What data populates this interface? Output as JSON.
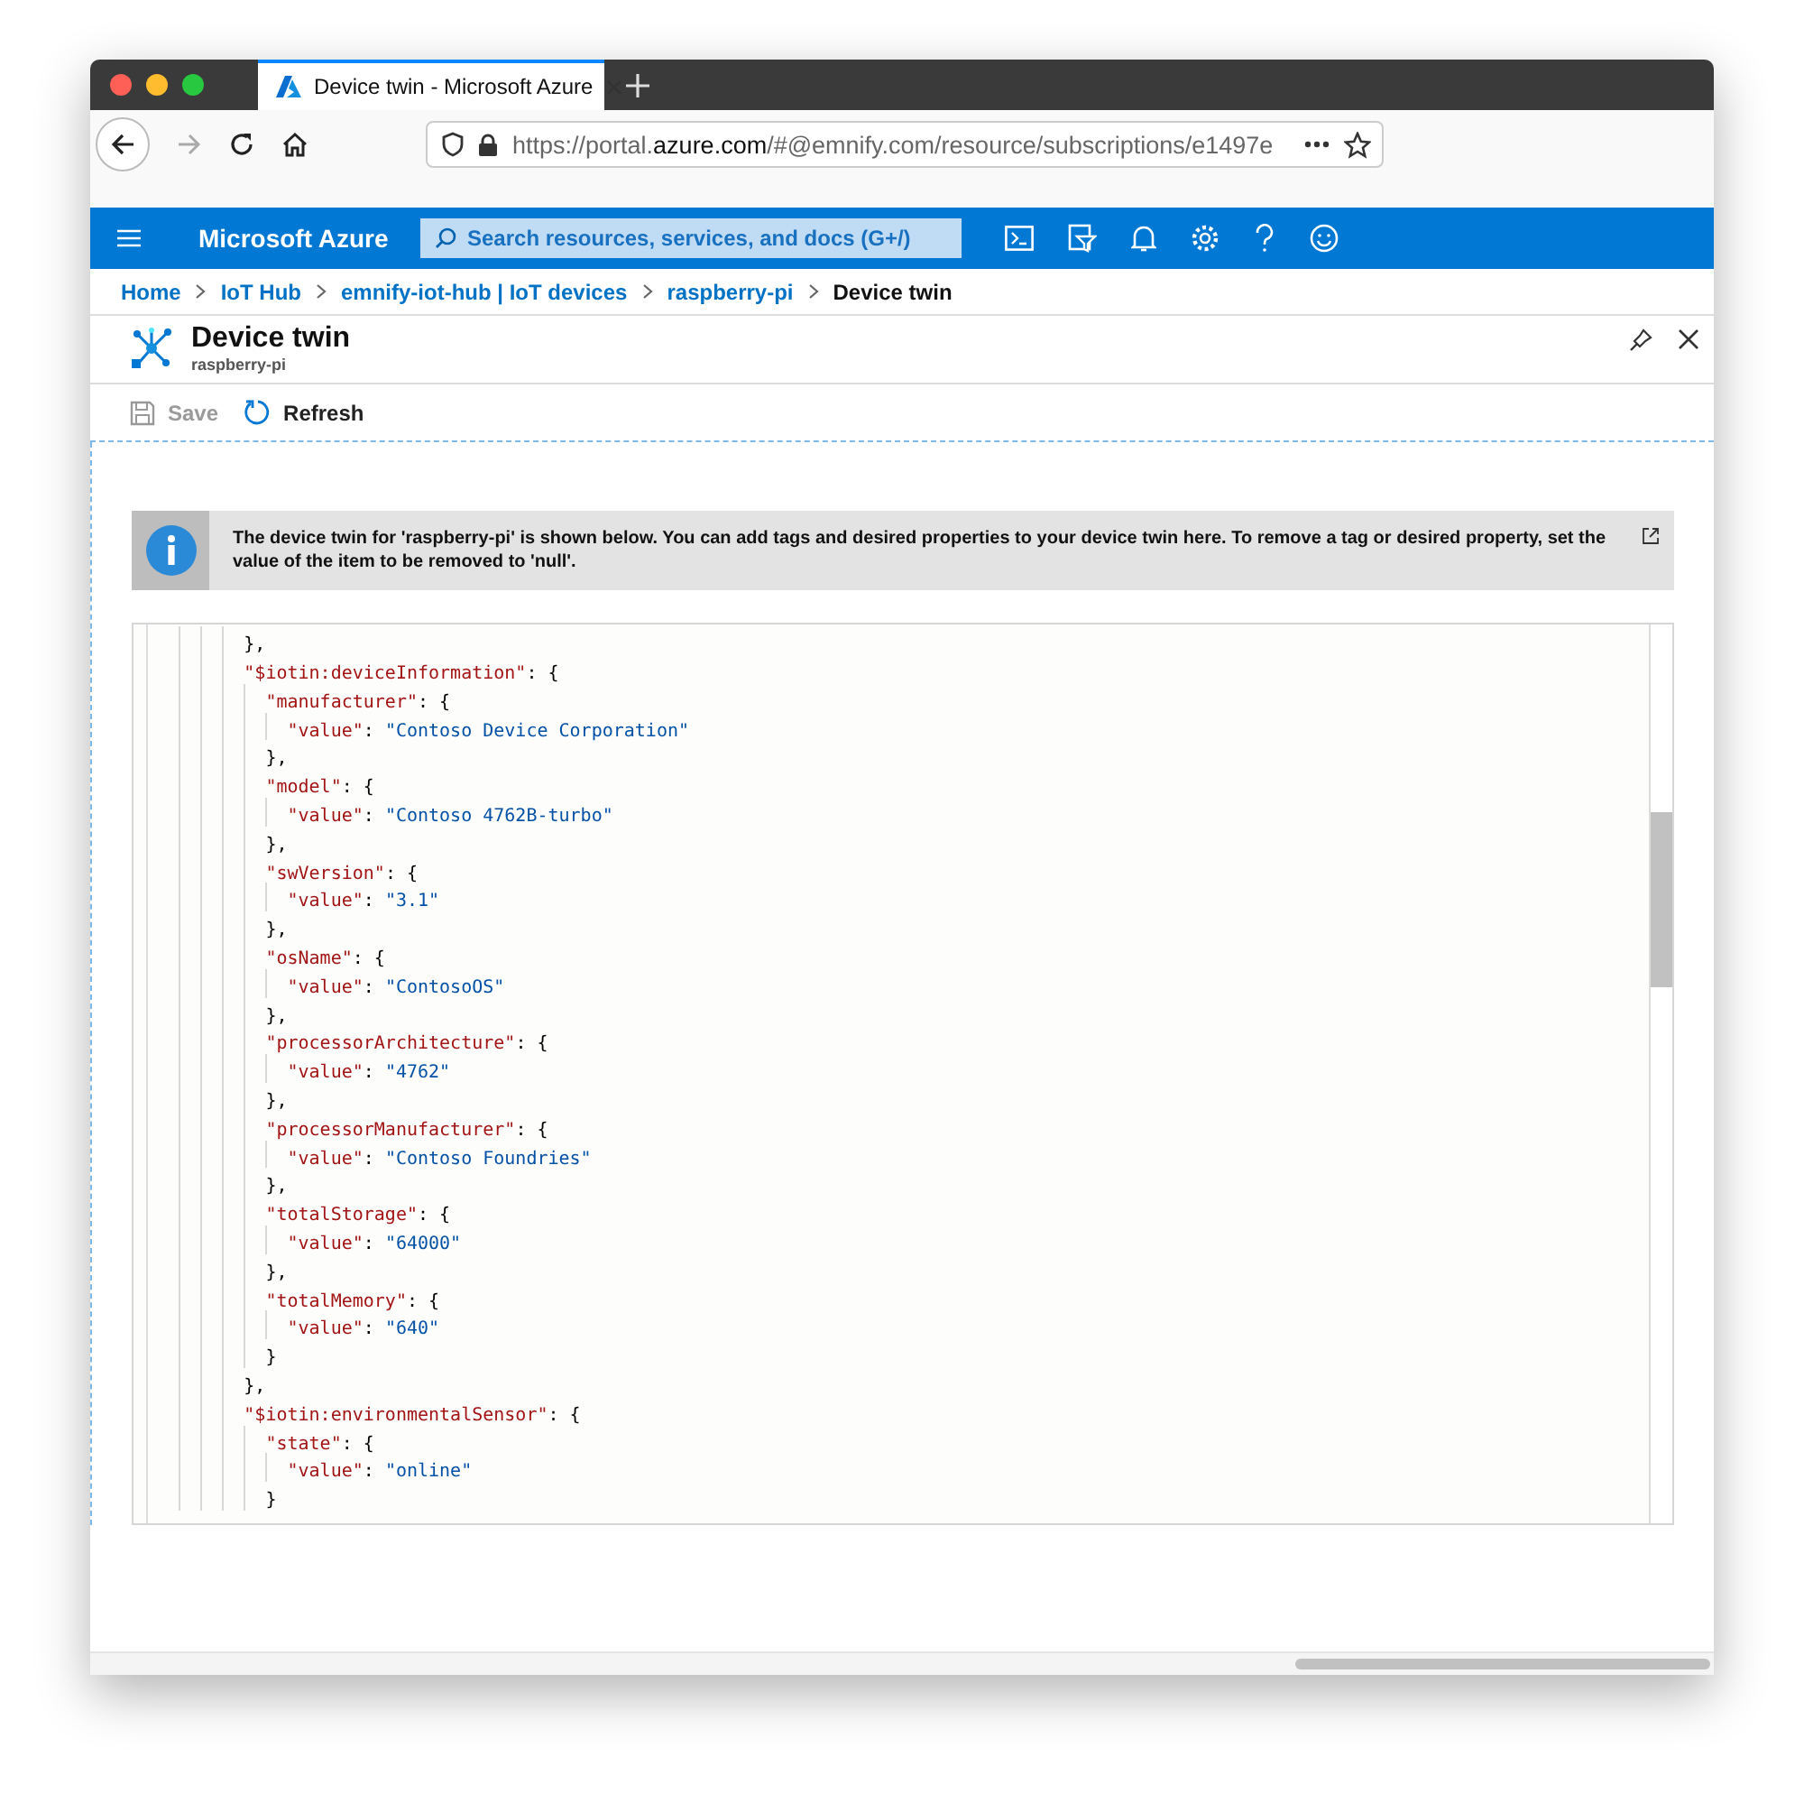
{
  "browser": {
    "tab": {
      "title": "Device twin - Microsoft Azure",
      "selected": true
    },
    "url": {
      "scheme": "https://portal.",
      "domain": "azure.com",
      "rest": "/#@emnify.com/resource/subscriptions/e1497e"
    }
  },
  "portal": {
    "brand": "Microsoft Azure",
    "search": {
      "placeholder": "Search resources, services, and docs (G+/)"
    }
  },
  "breadcrumb": [
    {
      "label": "Home",
      "current": false
    },
    {
      "label": "IoT Hub",
      "current": false
    },
    {
      "label": "emnify-iot-hub | IoT devices",
      "current": false
    },
    {
      "label": "raspberry-pi",
      "current": false
    },
    {
      "label": "Device twin",
      "current": true
    }
  ],
  "blade": {
    "title": "Device twin",
    "subtitle": "raspberry-pi"
  },
  "commands": [
    {
      "kind": "save",
      "label": "Save",
      "disabled": true
    },
    {
      "kind": "refresh",
      "label": "Refresh",
      "disabled": false
    }
  ],
  "info": {
    "text": "The device twin for 'raspberry-pi' is shown below. You can add tags and desired properties to your device twin here. To remove a tag or desired property, set the value of the item to be removed to 'null'."
  },
  "editor": {
    "lines": [
      {
        "tokens": [
          {
            "kind": "punct",
            "text": "        },"
          }
        ]
      },
      {
        "tokens": [
          {
            "kind": "key",
            "text": "        \"$iotin:deviceInformation\""
          },
          {
            "kind": "punct",
            "text": ": {"
          }
        ]
      },
      {
        "tokens": [
          {
            "kind": "key",
            "text": "          \"manufacturer\""
          },
          {
            "kind": "punct",
            "text": ": {"
          }
        ]
      },
      {
        "tokens": [
          {
            "kind": "key",
            "text": "            \"value\""
          },
          {
            "kind": "punct",
            "text": ": "
          },
          {
            "kind": "string",
            "text": "\"Contoso Device Corporation\""
          }
        ]
      },
      {
        "tokens": [
          {
            "kind": "punct",
            "text": "          },"
          }
        ]
      },
      {
        "tokens": [
          {
            "kind": "key",
            "text": "          \"model\""
          },
          {
            "kind": "punct",
            "text": ": {"
          }
        ]
      },
      {
        "tokens": [
          {
            "kind": "key",
            "text": "            \"value\""
          },
          {
            "kind": "punct",
            "text": ": "
          },
          {
            "kind": "string",
            "text": "\"Contoso 4762B-turbo\""
          }
        ]
      },
      {
        "tokens": [
          {
            "kind": "punct",
            "text": "          },"
          }
        ]
      },
      {
        "tokens": [
          {
            "kind": "key",
            "text": "          \"swVersion\""
          },
          {
            "kind": "punct",
            "text": ": {"
          }
        ]
      },
      {
        "tokens": [
          {
            "kind": "key",
            "text": "            \"value\""
          },
          {
            "kind": "punct",
            "text": ": "
          },
          {
            "kind": "string",
            "text": "\"3.1\""
          }
        ]
      },
      {
        "tokens": [
          {
            "kind": "punct",
            "text": "          },"
          }
        ]
      },
      {
        "tokens": [
          {
            "kind": "key",
            "text": "          \"osName\""
          },
          {
            "kind": "punct",
            "text": ": {"
          }
        ]
      },
      {
        "tokens": [
          {
            "kind": "key",
            "text": "            \"value\""
          },
          {
            "kind": "punct",
            "text": ": "
          },
          {
            "kind": "string",
            "text": "\"ContosoOS\""
          }
        ]
      },
      {
        "tokens": [
          {
            "kind": "punct",
            "text": "          },"
          }
        ]
      },
      {
        "tokens": [
          {
            "kind": "key",
            "text": "          \"processorArchitecture\""
          },
          {
            "kind": "punct",
            "text": ": {"
          }
        ]
      },
      {
        "tokens": [
          {
            "kind": "key",
            "text": "            \"value\""
          },
          {
            "kind": "punct",
            "text": ": "
          },
          {
            "kind": "string",
            "text": "\"4762\""
          }
        ]
      },
      {
        "tokens": [
          {
            "kind": "punct",
            "text": "          },"
          }
        ]
      },
      {
        "tokens": [
          {
            "kind": "key",
            "text": "          \"processorManufacturer\""
          },
          {
            "kind": "punct",
            "text": ": {"
          }
        ]
      },
      {
        "tokens": [
          {
            "kind": "key",
            "text": "            \"value\""
          },
          {
            "kind": "punct",
            "text": ": "
          },
          {
            "kind": "string",
            "text": "\"Contoso Foundries\""
          }
        ]
      },
      {
        "tokens": [
          {
            "kind": "punct",
            "text": "          },"
          }
        ]
      },
      {
        "tokens": [
          {
            "kind": "key",
            "text": "          \"totalStorage\""
          },
          {
            "kind": "punct",
            "text": ": {"
          }
        ]
      },
      {
        "tokens": [
          {
            "kind": "key",
            "text": "            \"value\""
          },
          {
            "kind": "punct",
            "text": ": "
          },
          {
            "kind": "string",
            "text": "\"64000\""
          }
        ]
      },
      {
        "tokens": [
          {
            "kind": "punct",
            "text": "          },"
          }
        ]
      },
      {
        "tokens": [
          {
            "kind": "key",
            "text": "          \"totalMemory\""
          },
          {
            "kind": "punct",
            "text": ": {"
          }
        ]
      },
      {
        "tokens": [
          {
            "kind": "key",
            "text": "            \"value\""
          },
          {
            "kind": "punct",
            "text": ": "
          },
          {
            "kind": "string",
            "text": "\"640\""
          }
        ]
      },
      {
        "tokens": [
          {
            "kind": "punct",
            "text": "          }"
          }
        ]
      },
      {
        "tokens": [
          {
            "kind": "punct",
            "text": "        },"
          }
        ]
      },
      {
        "tokens": [
          {
            "kind": "key",
            "text": "        \"$iotin:environmentalSensor\""
          },
          {
            "kind": "punct",
            "text": ": {"
          }
        ]
      },
      {
        "tokens": [
          {
            "kind": "key",
            "text": "          \"state\""
          },
          {
            "kind": "punct",
            "text": ": {"
          }
        ]
      },
      {
        "tokens": [
          {
            "kind": "key",
            "text": "            \"value\""
          },
          {
            "kind": "punct",
            "text": ": "
          },
          {
            "kind": "string",
            "text": "\"online\""
          }
        ]
      },
      {
        "tokens": [
          {
            "kind": "punct",
            "text": "          }"
          }
        ]
      }
    ]
  }
}
